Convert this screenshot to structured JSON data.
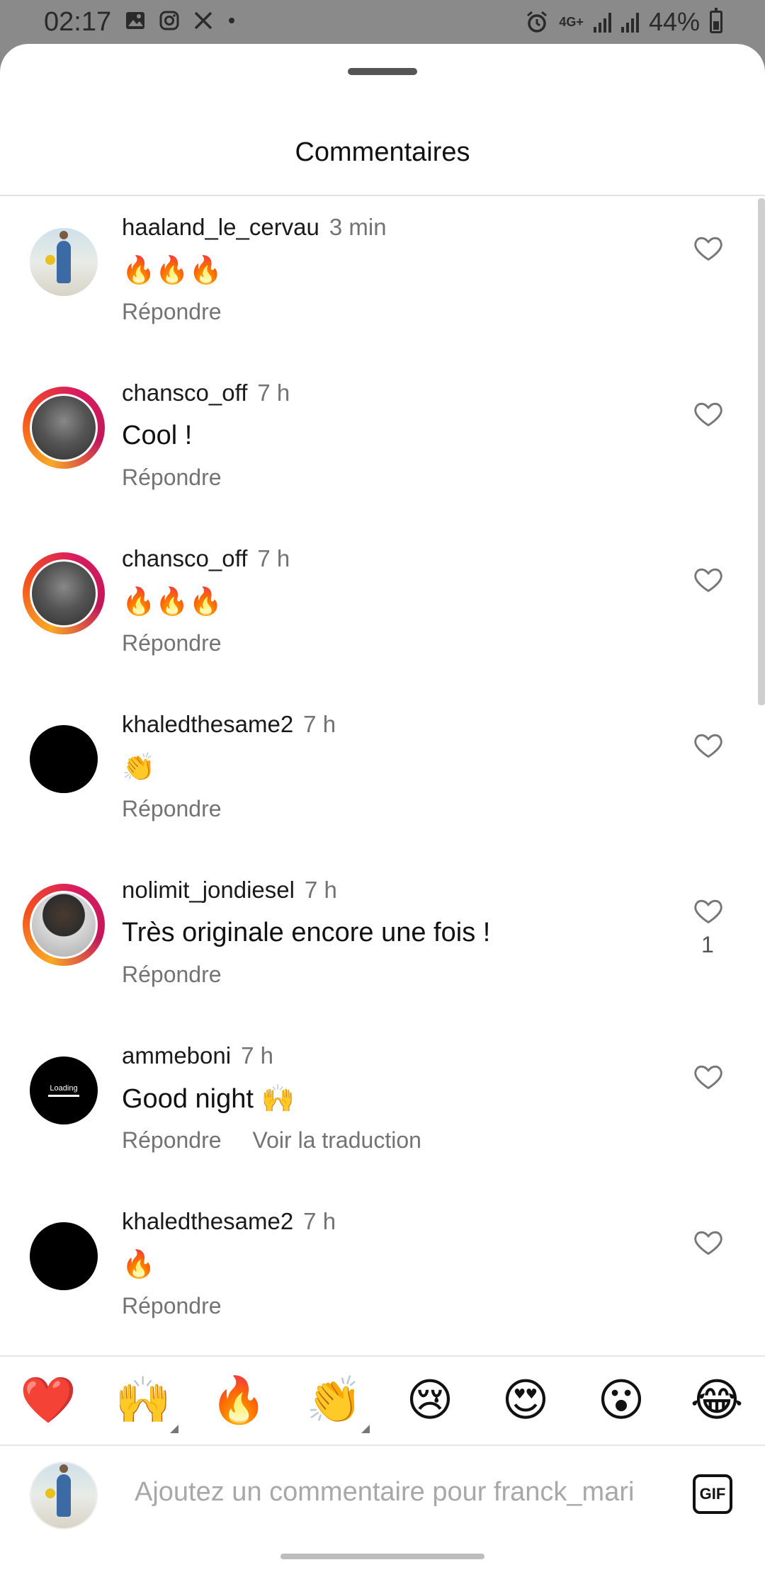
{
  "status_bar": {
    "time": "02:17",
    "network": "4G+",
    "battery": "44%",
    "left_icons": [
      "gallery-icon",
      "instagram-icon",
      "x-icon",
      "dot-icon"
    ],
    "right_icons": [
      "alarm-icon",
      "network-icon",
      "signal-icon",
      "signal-icon",
      "battery-icon"
    ]
  },
  "sheet": {
    "title": "Commentaires"
  },
  "comments": [
    {
      "username": "haaland_le_cervau",
      "time": "3 min",
      "text": "🔥🔥🔥",
      "reply": "Répondre",
      "likes": "",
      "avatar": "photo-light",
      "ring": false
    },
    {
      "username": "chansco_off",
      "time": "7 h",
      "text": "Cool !",
      "reply": "Répondre",
      "likes": "",
      "avatar": "photo-gray",
      "ring": true
    },
    {
      "username": "chansco_off",
      "time": "7 h",
      "text": "🔥🔥🔥",
      "reply": "Répondre",
      "likes": "",
      "avatar": "photo-gray",
      "ring": true
    },
    {
      "username": "khaledthesame2",
      "time": "7 h",
      "text": "👏",
      "reply": "Répondre",
      "likes": "",
      "avatar": "black",
      "ring": false
    },
    {
      "username": "nolimit_jondiesel",
      "time": "7 h",
      "text": "Très originale encore une fois !",
      "reply": "Répondre",
      "likes": "1",
      "avatar": "photo-portrait",
      "ring": true
    },
    {
      "username": "ammeboni",
      "time": "7 h",
      "text": "Good night 🙌",
      "reply": "Répondre",
      "translate": "Voir la traduction",
      "likes": "",
      "avatar": "loading",
      "ring": false
    },
    {
      "username": "khaledthesame2",
      "time": "7 h",
      "text": "🔥",
      "reply": "Répondre",
      "likes": "",
      "avatar": "black",
      "ring": false
    }
  ],
  "avatar_loading_text": "Loading",
  "emoji_bar": [
    "❤️",
    "🙌",
    "🔥",
    "👏",
    "😢",
    "😍",
    "😮",
    "😂"
  ],
  "input": {
    "placeholder": "Ajoutez un commentaire pour franck_mari",
    "gif_label": "GIF"
  },
  "colors": {
    "status_bar_bg": "#8a8a8a",
    "ring_gradient": [
      "#f9a825",
      "#d81b60"
    ],
    "secondary_text": "#737373"
  }
}
